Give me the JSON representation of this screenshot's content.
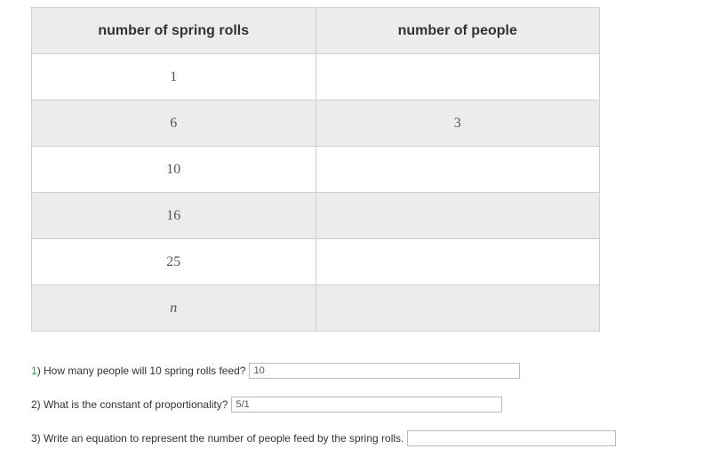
{
  "table": {
    "headers": {
      "col1": "number of spring rolls",
      "col2": "number of people"
    },
    "rows": [
      {
        "c1": "1",
        "c2": ""
      },
      {
        "c1": "6",
        "c2": "3"
      },
      {
        "c1": "10",
        "c2": ""
      },
      {
        "c1": "16",
        "c2": ""
      },
      {
        "c1": "25",
        "c2": ""
      },
      {
        "c1": "n",
        "c2": ""
      }
    ]
  },
  "questions": {
    "q1": {
      "num": "1",
      "text": ") How many people will 10 spring rolls feed?",
      "value": "10"
    },
    "q2": {
      "text": "2) What is the constant of proportionality?",
      "value": "5/1"
    },
    "q3": {
      "text": "3) Write an equation to represent the number of people feed by the spring rolls.",
      "value": ""
    }
  }
}
